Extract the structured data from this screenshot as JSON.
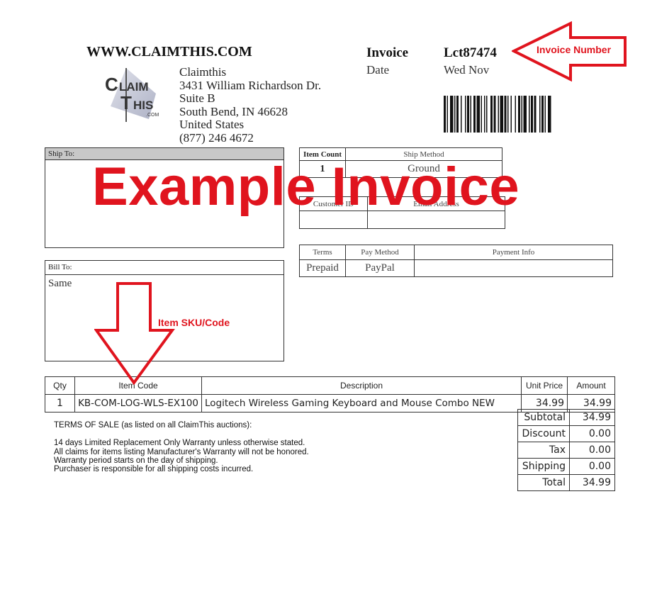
{
  "site": "WWW.CLAIMTHIS.COM",
  "logo": {
    "text_top": "LAIM",
    "text_bottom": "HIS",
    "text_com": ".COM"
  },
  "company": {
    "name": "Claimthis",
    "address1": "3431 William Richardson Dr.",
    "address2": "Suite B",
    "city": "South Bend, IN  46628",
    "country": "United States",
    "phone": "(877) 246 4672"
  },
  "invoice": {
    "label": "Invoice",
    "number": "Lct87474",
    "date_label": "Date",
    "date_value": "Wed Nov"
  },
  "ship_to": {
    "label": "Ship To:"
  },
  "bill_to": {
    "label": "Bill To:",
    "value": "Same"
  },
  "shipping": {
    "headers": [
      "Item Count",
      "Ship Method"
    ],
    "values": [
      "1",
      "Ground"
    ],
    "customer_id_label": "Customer ID",
    "email_label": "Email Address"
  },
  "payment": {
    "headers": [
      "Terms",
      "Pay Method",
      "Payment Info"
    ],
    "values": [
      "Prepaid",
      "PayPal",
      ""
    ]
  },
  "items": {
    "headers": [
      "Qty",
      "Item Code",
      "Description",
      "Unit Price",
      "Amount"
    ],
    "rows": [
      [
        "1",
        "KB-COM-LOG-WLS-EX100",
        "Logitech Wireless Gaming Keyboard and Mouse Combo NEW",
        "34.99",
        "34.99"
      ]
    ]
  },
  "totals": [
    [
      "Subtotal",
      "34.99"
    ],
    [
      "Discount",
      "0.00"
    ],
    [
      "Tax",
      "0.00"
    ],
    [
      "Shipping",
      "0.00"
    ],
    [
      "Total",
      "34.99"
    ]
  ],
  "terms": {
    "title": "TERMS OF SALE (as listed on all ClaimThis auctions):",
    "lines": [
      "14 days Limited Replacement Only Warranty unless otherwise stated.",
      "All claims for items listing Manufacturer's Warranty will not be honored.",
      "Warranty period starts on the day of shipping.",
      "Purchaser is responsible for all shipping costs incurred."
    ]
  },
  "annotations": {
    "invoice_number": "Invoice Number",
    "item_sku": "Item SKU/Code",
    "watermark": "Example Invoice"
  },
  "colors": {
    "annotation_red": "#e0141e",
    "header_grey": "#c8c8c8"
  }
}
